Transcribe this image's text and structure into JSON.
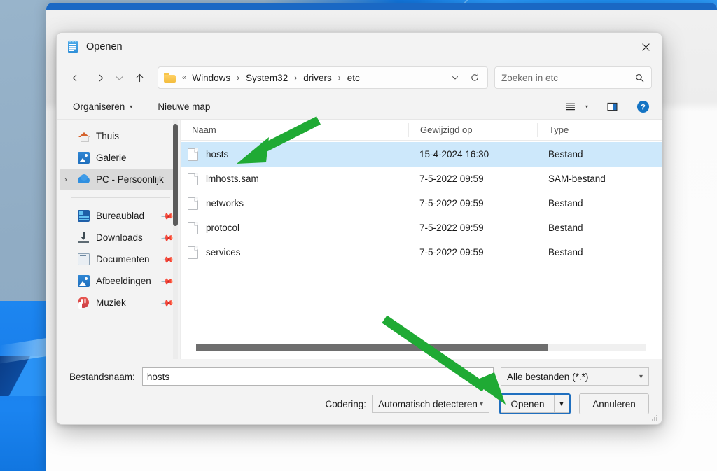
{
  "window": {
    "title": "Openen",
    "icon": "notepad-icon",
    "close_label": "×"
  },
  "nav": {
    "back_icon": "arrow-left-icon",
    "forward_icon": "arrow-right-icon",
    "recent_icon": "chevron-down-icon",
    "up_icon": "arrow-up-icon",
    "folder_icon": "folder-icon",
    "breadcrumb_prefix": "«",
    "breadcrumbs": [
      "Windows",
      "System32",
      "drivers",
      "etc"
    ],
    "dropdown_icon": "chevron-down-icon",
    "refresh_icon": "refresh-icon"
  },
  "search": {
    "placeholder": "Zoeken in etc",
    "value": "",
    "icon": "search-icon"
  },
  "commandbar": {
    "organize_label": "Organiseren",
    "new_folder_label": "Nieuwe map",
    "view_icon": "view-list-icon",
    "preview_icon": "preview-pane-icon",
    "help_icon": "help-icon"
  },
  "sidebar": {
    "items": [
      {
        "label": "Thuis",
        "icon": "home-icon",
        "selected": false,
        "pinned": false,
        "expandable": false
      },
      {
        "label": "Galerie",
        "icon": "gallery-icon",
        "selected": false,
        "pinned": false,
        "expandable": false
      },
      {
        "label": "PC - Persoonlijk",
        "icon": "onedrive-cloud-icon",
        "selected": true,
        "pinned": false,
        "expandable": true
      }
    ],
    "items2": [
      {
        "label": "Bureaublad",
        "icon": "desktop-icon",
        "pinned": true
      },
      {
        "label": "Downloads",
        "icon": "download-icon",
        "pinned": true
      },
      {
        "label": "Documenten",
        "icon": "documents-icon",
        "pinned": true
      },
      {
        "label": "Afbeeldingen",
        "icon": "pictures-icon",
        "pinned": true
      },
      {
        "label": "Muziek",
        "icon": "music-icon",
        "pinned": true
      }
    ]
  },
  "filelist": {
    "columns": [
      "Naam",
      "Gewijzigd op",
      "Type"
    ],
    "rows": [
      {
        "name": "hosts",
        "modified": "15-4-2024 16:30",
        "type": "Bestand",
        "selected": true
      },
      {
        "name": "lmhosts.sam",
        "modified": "7-5-2022 09:59",
        "type": "SAM-bestand",
        "selected": false
      },
      {
        "name": "networks",
        "modified": "7-5-2022 09:59",
        "type": "Bestand",
        "selected": false
      },
      {
        "name": "protocol",
        "modified": "7-5-2022 09:59",
        "type": "Bestand",
        "selected": false
      },
      {
        "name": "services",
        "modified": "7-5-2022 09:59",
        "type": "Bestand",
        "selected": false
      }
    ]
  },
  "footer": {
    "filename_label": "Bestandsnaam:",
    "filename_value": "hosts",
    "filetype_value": "Alle bestanden  (*.*)",
    "encoding_label": "Codering:",
    "encoding_value": "Automatisch detecteren",
    "open_label": "Openen",
    "open_split_icon": "chevron-down-icon",
    "cancel_label": "Annuleren"
  },
  "annotations": {
    "accent_color": "#1faa34",
    "arrow_1": "points-to-hosts-row",
    "arrow_2": "points-to-open-button"
  },
  "colors": {
    "selection_blue": "#cde8fb",
    "focus_border": "#1f6fbf",
    "window_chrome": "#f3f3f3",
    "arrow_green": "#1faa34"
  }
}
